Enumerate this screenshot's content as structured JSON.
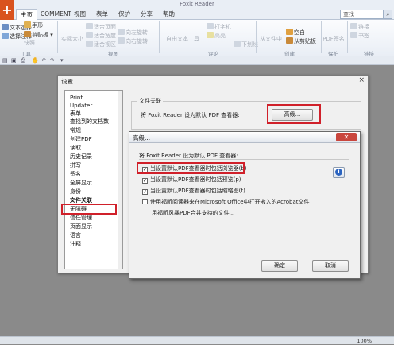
{
  "app": {
    "title": "Foxit Reader",
    "logo_glyph": "+"
  },
  "tabs": [
    "主页",
    "COMMENT",
    "视图",
    "表单",
    "保护",
    "分享",
    "帮助"
  ],
  "search": {
    "placeholder": "查找"
  },
  "ribbon": {
    "tools": [
      "文本选择",
      "选择注释",
      "手形",
      "快照",
      "剪贴板"
    ],
    "view": [
      "实际大小",
      "适合页面",
      "适合宽度",
      "适合视区",
      "向左旋转",
      "向右旋转"
    ],
    "comment": [
      "自由文本工具",
      "打字机",
      "高亮",
      "下划线"
    ],
    "create": [
      "从文件中",
      "空白",
      "从剪贴板"
    ],
    "protect": [
      "PDF签名"
    ],
    "links": [
      "链接",
      "书签"
    ],
    "groups": [
      "工具",
      "视图",
      "评论",
      "创建",
      "保护",
      "链接"
    ]
  },
  "status": {
    "zoom": "100%"
  },
  "settings_dialog": {
    "title": "设置",
    "close_glyph": "×",
    "categories": [
      "Print",
      "Updater",
      "表单",
      "查找到的文档数",
      "常规",
      "创建PDF",
      "读取",
      "历史记录",
      "拼写",
      "签名",
      "全屏显示",
      "身份",
      "文件关联",
      "无障碍",
      "信任管理",
      "页面显示",
      "语言",
      "注释"
    ],
    "selected_category": "文件关联",
    "group_label": "文件关联",
    "default_text": "将 Foxit Reader 设为默认 PDF 查看器:",
    "advanced_button": "高级..."
  },
  "advanced_dialog": {
    "title": "高级...",
    "close_glyph": "✕",
    "heading": "将 Foxit Reader 设为默认 PDF 查看器:",
    "options": [
      {
        "label": "当设置默认PDF查看器时包括浏览器(b)",
        "checked": true
      },
      {
        "label": "当设置默认PDF查看器时包括预览(p)",
        "checked": true
      },
      {
        "label": "当设置默认PDF查看器时包括缩略图(t)",
        "checked": true
      },
      {
        "label": "使用福昕阅读器来在Microsoft Office中打开嵌入的Acrobat文件",
        "checked": false
      }
    ],
    "sub_note": "用福昕风暴PDF合并支持的文件...",
    "ok_button": "确定",
    "cancel_button": "取消"
  },
  "colors": {
    "accent": "#d9531e",
    "highlight": "#d0202a",
    "info": "#2a63c0"
  }
}
